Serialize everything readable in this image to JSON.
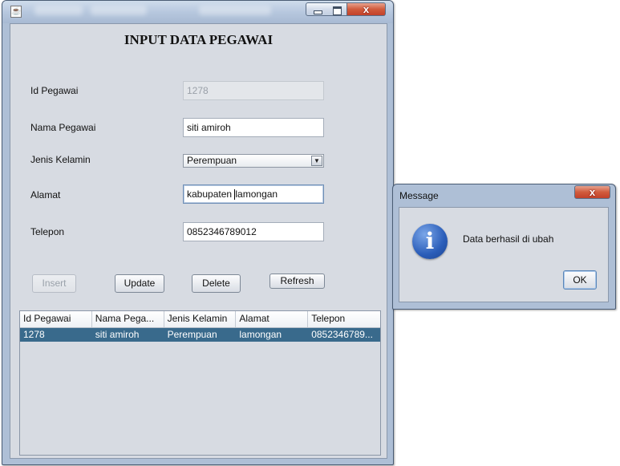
{
  "main_window": {
    "form_title": "INPUT DATA PEGAWAI",
    "fields": {
      "id": {
        "label": "Id Pegawai",
        "value": "1278"
      },
      "nama": {
        "label": "Nama Pegawai",
        "value": "siti amiroh"
      },
      "jenis_kelamin": {
        "label": "Jenis Kelamin",
        "value": "Perempuan"
      },
      "alamat": {
        "label": "Alamat",
        "value_before_caret": "kabupaten ",
        "value_after_caret": "lamongan"
      },
      "telepon": {
        "label": "Telepon",
        "value": "0852346789012"
      }
    },
    "buttons": {
      "insert": "Insert",
      "update": "Update",
      "delete": "Delete",
      "refresh": "Refresh"
    },
    "table": {
      "columns": [
        "Id Pegawai",
        "Nama Pega...",
        "Jenis Kelamin",
        "Alamat",
        "Telepon"
      ],
      "rows": [
        [
          "1278",
          "siti amiroh",
          "Perempuan",
          "lamongan",
          "0852346789..."
        ]
      ],
      "selected_row_color": "#396a8c"
    }
  },
  "message_dialog": {
    "title": "Message",
    "icon": "information-icon",
    "message": "Data berhasil di ubah",
    "ok_label": "OK"
  },
  "window_controls": {
    "close_glyph": "x"
  }
}
